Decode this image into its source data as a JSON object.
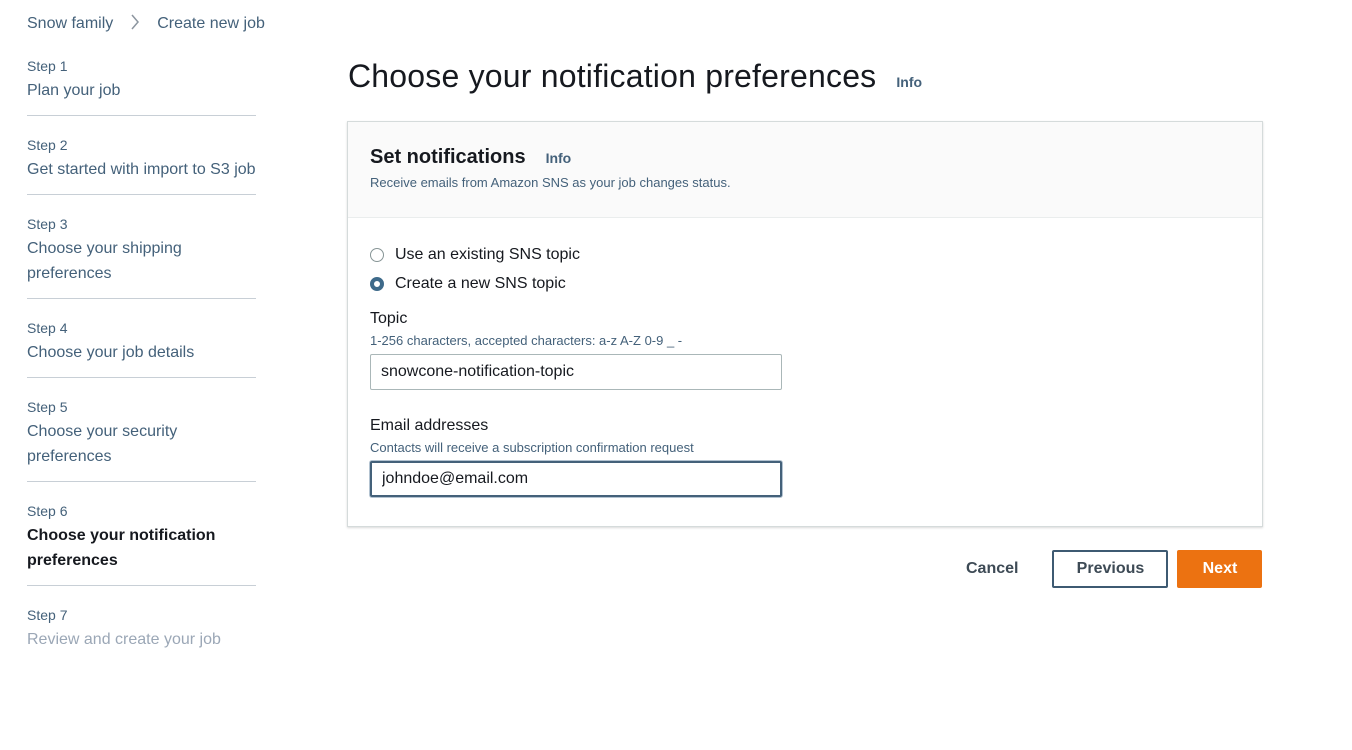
{
  "breadcrumb": {
    "parent": "Snow family",
    "separator_icon": "chevron-right-icon",
    "current": "Create new job"
  },
  "steps": [
    {
      "number": "Step 1",
      "title": "Plan your job",
      "state": "link"
    },
    {
      "number": "Step 2",
      "title": "Get started with import to S3 job",
      "state": "link"
    },
    {
      "number": "Step 3",
      "title": "Choose your shipping preferences",
      "state": "link"
    },
    {
      "number": "Step 4",
      "title": "Choose your job details",
      "state": "link"
    },
    {
      "number": "Step 5",
      "title": "Choose your security preferences",
      "state": "link"
    },
    {
      "number": "Step 6",
      "title": "Choose your notification preferences",
      "state": "active"
    },
    {
      "number": "Step 7",
      "title": "Review and create your job",
      "state": "disabled"
    }
  ],
  "page": {
    "title": "Choose your notification preferences",
    "info_label": "Info"
  },
  "notifications": {
    "header": "Set notifications",
    "info_label": "Info",
    "description": "Receive emails from Amazon SNS as your job changes status.",
    "options": [
      {
        "label": "Use an existing SNS topic",
        "selected": false
      },
      {
        "label": "Create a new SNS topic",
        "selected": true
      }
    ],
    "topic": {
      "label": "Topic",
      "description": "1-256 characters, accepted characters: a-z A-Z 0-9 _ -",
      "value": "snowcone-notification-topic"
    },
    "email": {
      "label": "Email addresses",
      "description": "Contacts will receive a subscription confirmation request",
      "value": "johndoe@email.com"
    }
  },
  "actions": {
    "cancel": "Cancel",
    "previous": "Previous",
    "next": "Next"
  },
  "colors": {
    "primary_button": "#ec7211",
    "link_text": "#44617a",
    "radio_selected": "#3e6a8a"
  }
}
